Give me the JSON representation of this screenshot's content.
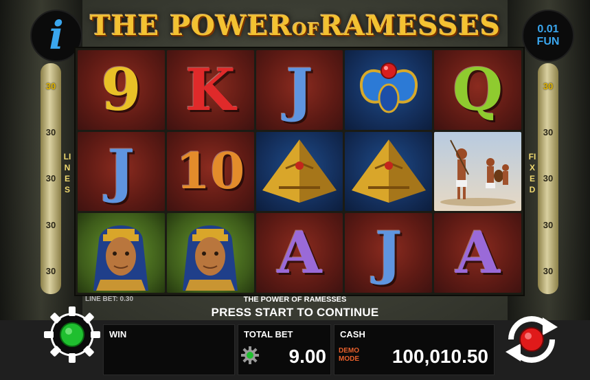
{
  "game": {
    "title_main_1": "THE",
    "title_main_2": "POWER",
    "title_small": "OF",
    "title_main_3": "RAMESSES",
    "name": "THE POWER OF RAMESSES"
  },
  "info_button": {
    "glyph": "i"
  },
  "denomination": {
    "value": "0.01",
    "currency": "FUN"
  },
  "paylines": {
    "left_label": "LINES",
    "right_label": "FIXED",
    "left_numbers": [
      "30",
      "30",
      "30",
      "30",
      "30"
    ],
    "right_numbers": [
      "30",
      "30",
      "30",
      "30",
      "30"
    ]
  },
  "reels": {
    "rows": [
      [
        {
          "symbol": "9",
          "icon": "nine-symbol",
          "style": "red",
          "color": "#e9c127"
        },
        {
          "symbol": "K",
          "icon": "king-symbol",
          "style": "red",
          "color": "#e02a2a"
        },
        {
          "symbol": "J",
          "icon": "jack-symbol",
          "style": "red",
          "color": "#5f95e0"
        },
        {
          "symbol": "",
          "icon": "scarab-symbol",
          "style": "blue",
          "color": "#2f67d0"
        },
        {
          "symbol": "Q",
          "icon": "queen-symbol",
          "style": "red",
          "color": "#8fcb2f"
        }
      ],
      [
        {
          "symbol": "J",
          "icon": "jack-symbol",
          "style": "red",
          "color": "#5f95e0"
        },
        {
          "symbol": "10",
          "icon": "ten-symbol",
          "style": "red",
          "color": "#e38c2b"
        },
        {
          "symbol": "",
          "icon": "pyramid-symbol",
          "style": "blue",
          "color": "#d9a62a"
        },
        {
          "symbol": "",
          "icon": "pyramid-symbol",
          "style": "blue",
          "color": "#d9a62a"
        },
        {
          "symbol": "",
          "icon": "warriors-symbol",
          "style": "sky",
          "color": "#a0522d"
        }
      ],
      [
        {
          "symbol": "",
          "icon": "pharaoh-symbol",
          "style": "green",
          "color": "#c59a3b"
        },
        {
          "symbol": "",
          "icon": "pharaoh-symbol",
          "style": "green",
          "color": "#c59a3b"
        },
        {
          "symbol": "A",
          "icon": "ace-symbol",
          "style": "red",
          "color": "#9a6ad8"
        },
        {
          "symbol": "J",
          "icon": "jack-symbol",
          "style": "red",
          "color": "#5f95e0"
        },
        {
          "symbol": "A",
          "icon": "ace-symbol",
          "style": "red",
          "color": "#9a6ad8"
        }
      ]
    ]
  },
  "status": {
    "line_bet": "LINE BET: 0.30",
    "message": "PRESS START TO CONTINUE"
  },
  "panel": {
    "win_label": "WIN",
    "win_value": "",
    "total_bet_label": "TOTAL BET",
    "total_bet_value": "9.00",
    "cash_label": "CASH",
    "demo_line1": "DEMO",
    "demo_line2": "MODE",
    "cash_value": "100,010.50"
  },
  "colors": {
    "accent_blue": "#3aa6ee",
    "title_gold": "#f3c232",
    "settings_green": "#1fbf2f",
    "spin_red": "#e01a1a",
    "demo_orange": "#e8602c"
  }
}
